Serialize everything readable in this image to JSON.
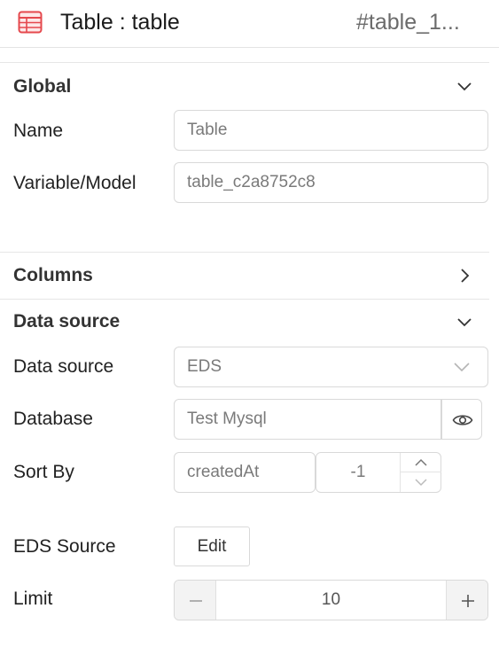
{
  "header": {
    "title": "Table : table",
    "element_id": "#table_1..."
  },
  "sections": {
    "global": {
      "title": "Global",
      "name_label": "Name",
      "name_value": "Table",
      "variable_label": "Variable/Model",
      "variable_value": "table_c2a8752c8",
      "expanded": true
    },
    "columns": {
      "title": "Columns",
      "expanded": false
    },
    "data_source": {
      "title": "Data source",
      "expanded": true,
      "source_label": "Data source",
      "source_value": "EDS",
      "database_label": "Database",
      "database_value": "Test Mysql",
      "sort_label": "Sort By",
      "sort_field": "createdAt",
      "sort_order": "-1",
      "eds_label": "EDS Source",
      "edit_label": "Edit",
      "limit_label": "Limit",
      "limit_value": "10"
    }
  },
  "colors": {
    "icon_accent": "#e5484d",
    "border": "#d9d9d9",
    "muted_text": "#7a7a7a"
  }
}
